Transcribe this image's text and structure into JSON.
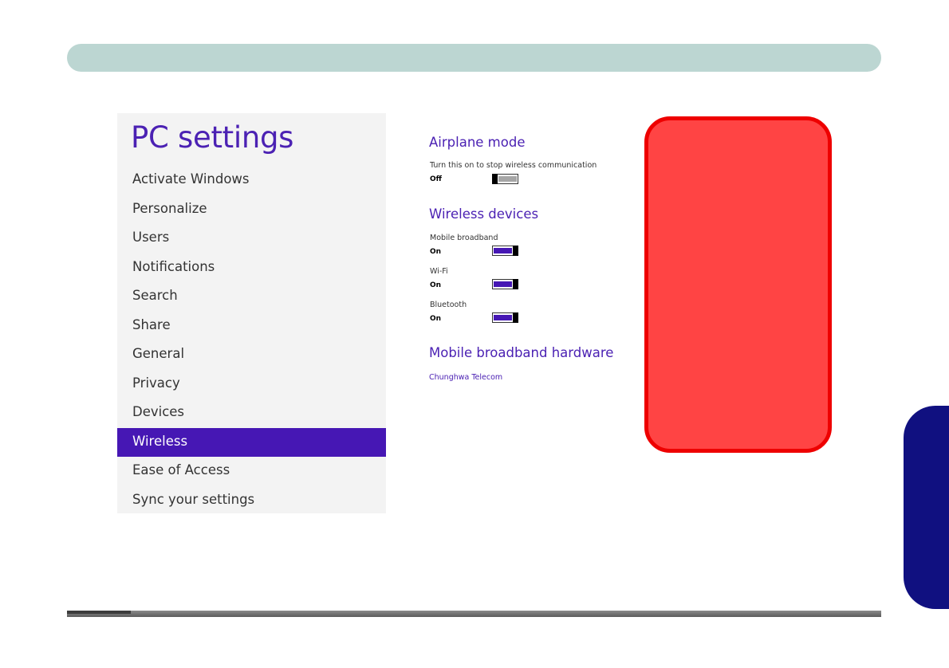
{
  "sidebar": {
    "title": "PC settings",
    "items": [
      {
        "label": "Activate Windows",
        "selected": false
      },
      {
        "label": "Personalize",
        "selected": false
      },
      {
        "label": "Users",
        "selected": false
      },
      {
        "label": "Notifications",
        "selected": false
      },
      {
        "label": "Search",
        "selected": false
      },
      {
        "label": "Share",
        "selected": false
      },
      {
        "label": "General",
        "selected": false
      },
      {
        "label": "Privacy",
        "selected": false
      },
      {
        "label": "Devices",
        "selected": false
      },
      {
        "label": "Wireless",
        "selected": true
      },
      {
        "label": "Ease of Access",
        "selected": false
      },
      {
        "label": "Sync your settings",
        "selected": false
      }
    ]
  },
  "airplane": {
    "title": "Airplane mode",
    "description": "Turn this on to stop wireless communication",
    "state": "Off"
  },
  "wireless_devices": {
    "title": "Wireless devices",
    "devices": [
      {
        "name": "Mobile broadband",
        "state": "On"
      },
      {
        "name": "Wi-Fi",
        "state": "On"
      },
      {
        "name": "Bluetooth",
        "state": "On"
      }
    ]
  },
  "hardware": {
    "title": "Mobile broadband hardware",
    "link": "Chunghwa Telecom"
  },
  "colors": {
    "accent": "#4617b4",
    "top_bar": "#bcd6d2",
    "side_tab": "#101080",
    "redaction": "#ff4444"
  }
}
